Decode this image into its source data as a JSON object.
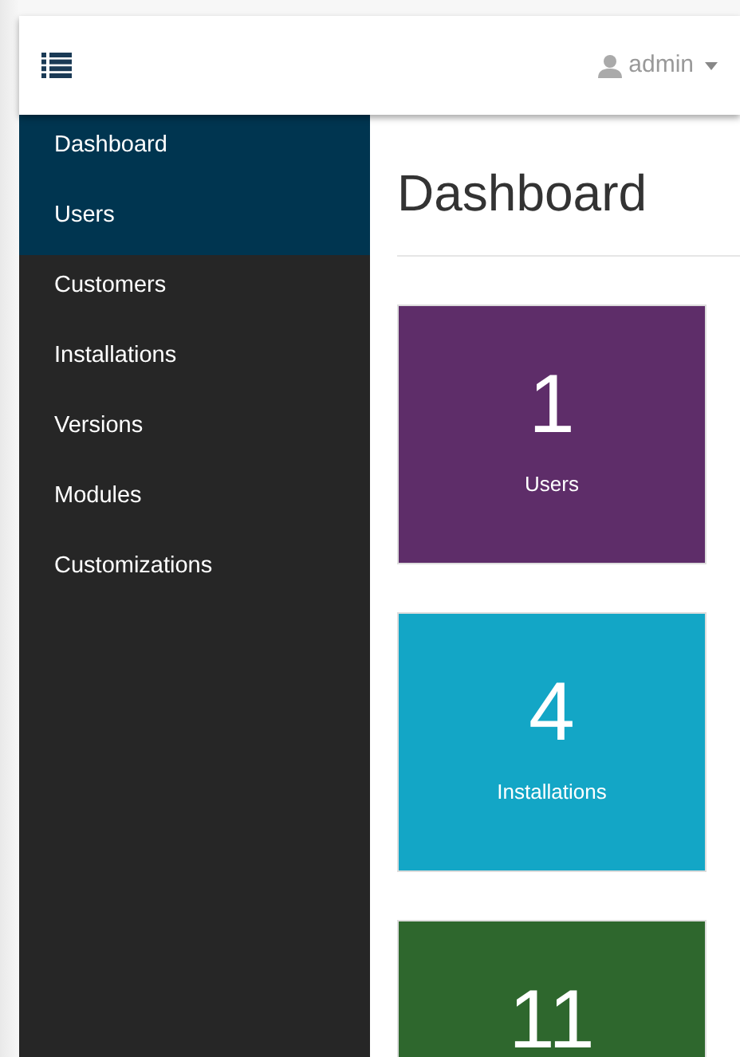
{
  "navbar": {
    "user": "admin"
  },
  "sidebar": {
    "items": [
      {
        "label": "Dashboard",
        "highlighted": true
      },
      {
        "label": "Users",
        "highlighted": true
      },
      {
        "label": "Customers",
        "highlighted": false
      },
      {
        "label": "Installations",
        "highlighted": false
      },
      {
        "label": "Versions",
        "highlighted": false
      },
      {
        "label": "Modules",
        "highlighted": false
      },
      {
        "label": "Customizations",
        "highlighted": false
      }
    ]
  },
  "page": {
    "title": "Dashboard"
  },
  "tiles": [
    {
      "count": "1",
      "label": "Users",
      "color": "#5e2d69"
    },
    {
      "count": "4",
      "label": "Installations",
      "color": "#13a6c6"
    },
    {
      "count": "11",
      "color": "#2e672d"
    }
  ]
}
